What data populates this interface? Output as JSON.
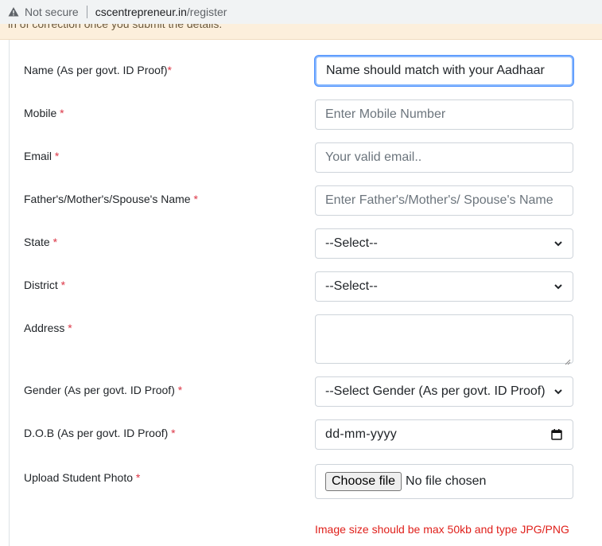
{
  "browser": {
    "security_label": "Not secure",
    "url_host": "cscentrepreneur.in",
    "url_path": "/register"
  },
  "notice": {
    "text": "in of correction once you submit the details."
  },
  "form": {
    "name_label": "Name (As per govt. ID Proof)",
    "name_value": "Name should match with your Aadhaar",
    "mobile_label": "Mobile",
    "mobile_placeholder": "Enter Mobile Number",
    "email_label": "Email",
    "email_placeholder": "Your valid email..",
    "guardian_label": "Father's/Mother's/Spouse's Name",
    "guardian_placeholder": "Enter Father's/Mother's/ Spouse's Name",
    "state_label": "State",
    "state_selected": "--Select--",
    "district_label": "District",
    "district_selected": "--Select--",
    "address_label": "Address",
    "gender_label": "Gender (As per govt. ID Proof)",
    "gender_selected": "--Select Gender (As per govt. ID Proof)",
    "dob_label": "D.O.B (As per govt. ID Proof)",
    "dob_value": "dd-mm-yyyy",
    "photo_label": "Upload Student Photo",
    "choose_file_label": "Choose file",
    "no_file_text": "No file chosen",
    "photo_hint": "Image size should be max 50kb and type JPG/PNG",
    "required_mark": "*"
  },
  "colors": {
    "required": "#dc3545",
    "hint": "#e0201b",
    "focus": "#86b7fe"
  }
}
